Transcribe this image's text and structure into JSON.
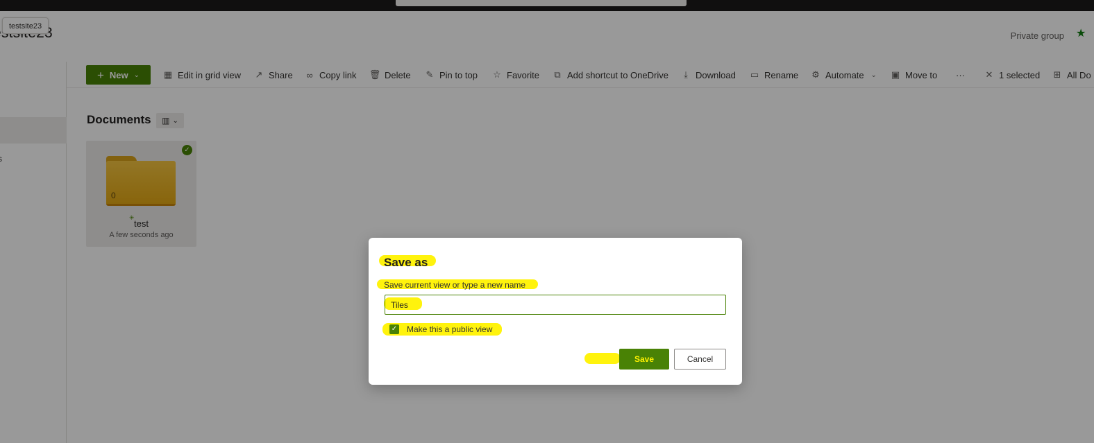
{
  "tooltip": "testsite23",
  "site": {
    "title": "estsite23",
    "privacy": "Private group"
  },
  "left_nav": {
    "partial_item": "s"
  },
  "command_bar": {
    "new_label": "New",
    "items": [
      {
        "label": "Edit in grid view",
        "icon": "grid-icon"
      },
      {
        "label": "Share",
        "icon": "share-icon"
      },
      {
        "label": "Copy link",
        "icon": "link-icon"
      },
      {
        "label": "Delete",
        "icon": "trash-icon"
      },
      {
        "label": "Pin to top",
        "icon": "pin-icon"
      },
      {
        "label": "Favorite",
        "icon": "star-icon"
      },
      {
        "label": "Add shortcut to OneDrive",
        "icon": "shortcut-icon"
      },
      {
        "label": "Download",
        "icon": "download-icon"
      },
      {
        "label": "Rename",
        "icon": "rename-icon"
      },
      {
        "label": "Automate",
        "icon": "automate-icon"
      },
      {
        "label": "Move to",
        "icon": "move-icon"
      },
      {
        "label": "···",
        "icon": "more-icon"
      },
      {
        "label": "1 selected",
        "icon": "close-icon"
      },
      {
        "label": "All Do",
        "icon": "view-icon"
      }
    ]
  },
  "library": {
    "title": "Documents",
    "view_icon": "tiles-view-icon"
  },
  "tile": {
    "item_count": "0",
    "name": "test",
    "modified": "A few seconds ago"
  },
  "dialog": {
    "title": "Save as",
    "field_label": "Save current view or type a new name",
    "view_name_value": "Tiles",
    "public_checkbox_label": "Make this a public view",
    "public_checked": true,
    "save_label": "Save",
    "cancel_label": "Cancel"
  },
  "colors": {
    "brand_green": "#498205",
    "highlight": "#fff200"
  }
}
